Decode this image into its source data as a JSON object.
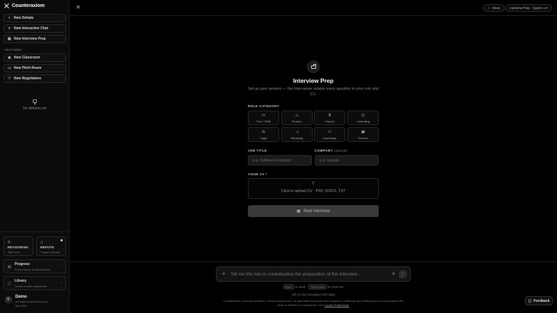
{
  "brand": {
    "name": "Counteraxiom"
  },
  "sidebar": {
    "actions": [
      {
        "label": "New Debate",
        "icon": "plus-icon"
      },
      {
        "label": "New Interactive Chat",
        "icon": "sparkle-icon"
      },
      {
        "label": "New Interview Prep",
        "icon": "grid-icon"
      }
    ],
    "section_label": "FEATURES",
    "features": [
      {
        "label": "New Classroom",
        "icon": "eye-icon"
      },
      {
        "label": "New Pitch Room",
        "icon": "presentation-icon"
      },
      {
        "label": "New Negotiation",
        "icon": "handshake-icon"
      }
    ],
    "empty_text": "No debates yet",
    "modes": [
      {
        "title": "REASONING",
        "subtitle": "Take time"
      },
      {
        "title": "REFUTE",
        "subtitle": "Today's rebuttal"
      }
    ],
    "nav": [
      {
        "title": "Progress",
        "subtitle": "Score history & improvement"
      },
      {
        "title": "Library",
        "subtitle": "Saved counter-arguments"
      }
    ],
    "user": {
      "initial": "D",
      "name": "Demo",
      "email": "demo@counteraxiom.com",
      "plan": "Max Plan"
    }
  },
  "topbar": {
    "share_label": "Share",
    "model_label": "Interview Prep · Cypher 1.0"
  },
  "main": {
    "title": "Interview Prep",
    "subtitle": "Set up your session — the interviewer adapts every question to your role and CV.",
    "role_label": "ROLE CATEGORY",
    "roles": [
      {
        "label": "Tech / SWE",
        "icon": "monitor-icon"
      },
      {
        "label": "Product",
        "icon": "triangle-icon"
      },
      {
        "label": "Finance",
        "icon": "dollar-icon"
      },
      {
        "label": "Consulting",
        "icon": "compass-icon"
      },
      {
        "label": "Legal",
        "icon": "scale-icon"
      },
      {
        "label": "Marketing",
        "icon": "megaphone-icon"
      },
      {
        "label": "Leadership",
        "icon": "users-icon"
      },
      {
        "label": "General",
        "icon": "briefcase-icon"
      }
    ],
    "job_title_label": "JOB TITLE",
    "job_title_placeholder": "e.g. Software Engineer",
    "company_label": "COMPANY",
    "company_optional": "(optional)",
    "company_placeholder": "e.g. Google",
    "cv_label": "YOUR CV *",
    "upload_text": "Click to upload CV · PDF, DOCX, TXT",
    "start_label": "Start Interview"
  },
  "composer": {
    "placeholder": "Tell me the role to contextualise the preparation of the interview...",
    "hint_key1": "Enter",
    "hint_text1": "to send",
    "hint_key2": "Shift+Enter",
    "hint_text2": "for new line",
    "counter": "100 of 100 messages left today",
    "disclaimer": "Counteraxiom can make mistakes. Check important info. AI generated responses are designed to challenge your thinking and do not represent the views or beliefs of Counteraxiom. See",
    "disclaimer_link": "Cookie Preferences"
  },
  "feedback_label": "Feedback"
}
